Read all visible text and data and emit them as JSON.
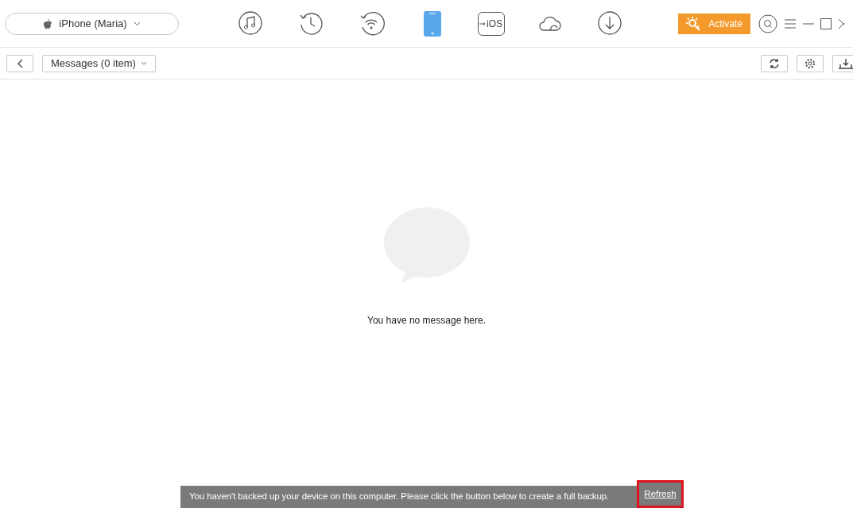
{
  "device_selector": {
    "label": "iPhone (Maria)"
  },
  "nav_tabs": [
    {
      "kind": "music",
      "selected": false
    },
    {
      "kind": "history",
      "selected": false
    },
    {
      "kind": "wifi",
      "selected": false
    },
    {
      "kind": "phone",
      "selected": true
    },
    {
      "kind": "ios",
      "text": "iOS",
      "selected": false
    },
    {
      "kind": "cloud",
      "selected": false
    },
    {
      "kind": "download",
      "selected": false
    }
  ],
  "activate_button": {
    "label": "Activate"
  },
  "toolbar": {
    "category_dropdown": "Messages (0 item)"
  },
  "empty_state": {
    "message": "You have no message here."
  },
  "notification": {
    "message": "You haven't backed up your device on this computer. Please click the button below to create a full backup.",
    "link": "Refresh",
    "link_highlighted": true
  }
}
